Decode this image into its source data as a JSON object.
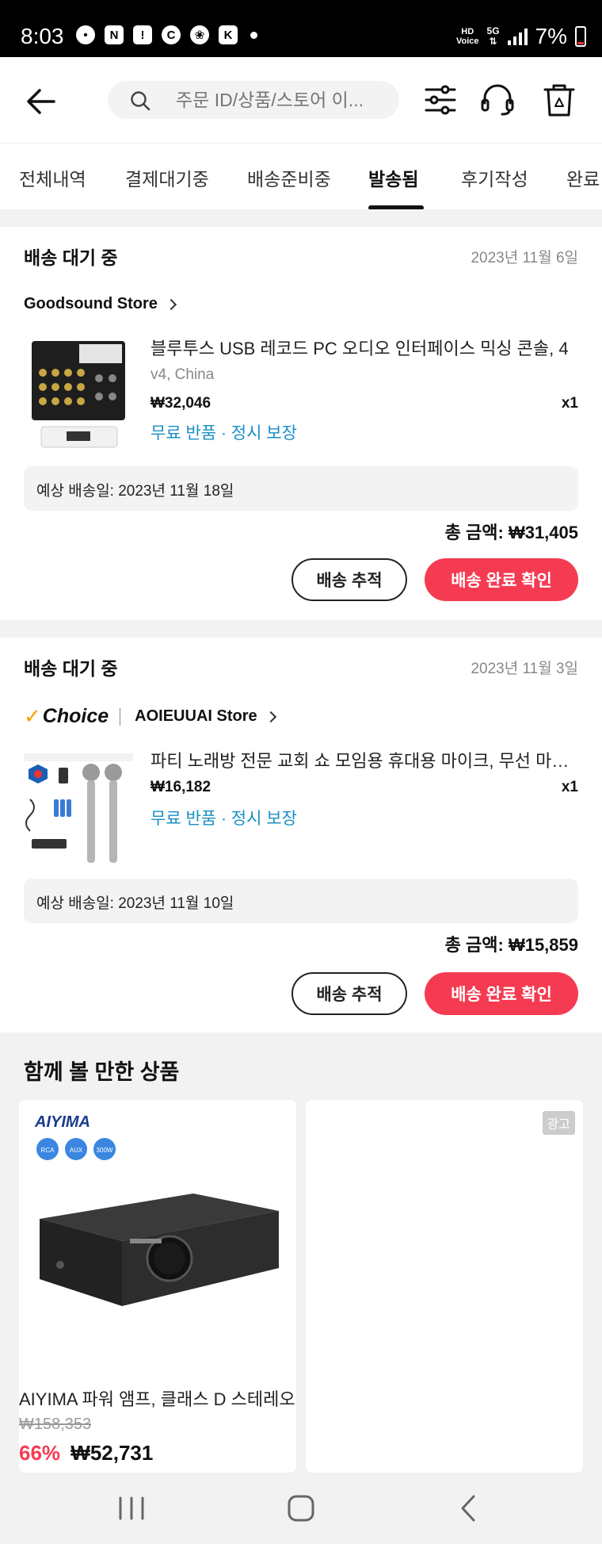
{
  "status_bar": {
    "time": "8:03",
    "notif_icons": [
      "•",
      "N",
      "!",
      "C",
      "❀",
      "K"
    ],
    "hd_label": "HD",
    "voice_label": "Voice",
    "network": "5G",
    "battery": "7%"
  },
  "search": {
    "placeholder": "주문 ID/상품/스토어 이..."
  },
  "tabs": [
    "전체내역",
    "결제대기중",
    "배송준비중",
    "발송됨",
    "후기작성",
    "완료"
  ],
  "orders": [
    {
      "status": "배송 대기 중",
      "date": "2023년 11월 6일",
      "store": "Goodsound Store",
      "choice": "",
      "title": "블루투스 USB 레코드 PC 오디오 인터페이스 믹싱 콘솔, 4",
      "variant": "v4, China",
      "price": "₩32,046",
      "qty": "x1",
      "tags": "무료 반품 · 정시 보장",
      "eta": "예상 배송일: 2023년 11월 18일",
      "total": "총 금액: ₩31,405",
      "track_label": "배송 추적",
      "confirm_label": "배송 완료 확인"
    },
    {
      "status": "배송 대기 중",
      "date": "2023년 11월 3일",
      "store": "AOIEUUAI Store",
      "choice": "Choice",
      "title": "파티 노래방 전문 교회 쇼 모임용 휴대용 마이크, 무선 마이크",
      "variant": "",
      "price": "₩16,182",
      "qty": "x1",
      "tags": "무료 반품 · 정시 보장",
      "eta": "예상 배송일: 2023년 11월 10일",
      "total": "총 금액: ₩15,859",
      "track_label": "배송 추적",
      "confirm_label": "배송 완료 확인"
    }
  ],
  "recommend": {
    "title": "함께 볼 만한 상품",
    "brand": "AIYIMA",
    "spec_badges": [
      "RCA",
      "AUX",
      "300W"
    ],
    "items": [
      {
        "name": "AIYIMA 파워 앰프, 클래스 D 스테레오",
        "orig_price": "₩158,353",
        "discount": "66%",
        "price": "₩52,731"
      }
    ],
    "ad_label": "광고"
  },
  "colors": {
    "accent": "#f53b52",
    "link": "#1a8fc4",
    "choice": "#f5a000"
  }
}
